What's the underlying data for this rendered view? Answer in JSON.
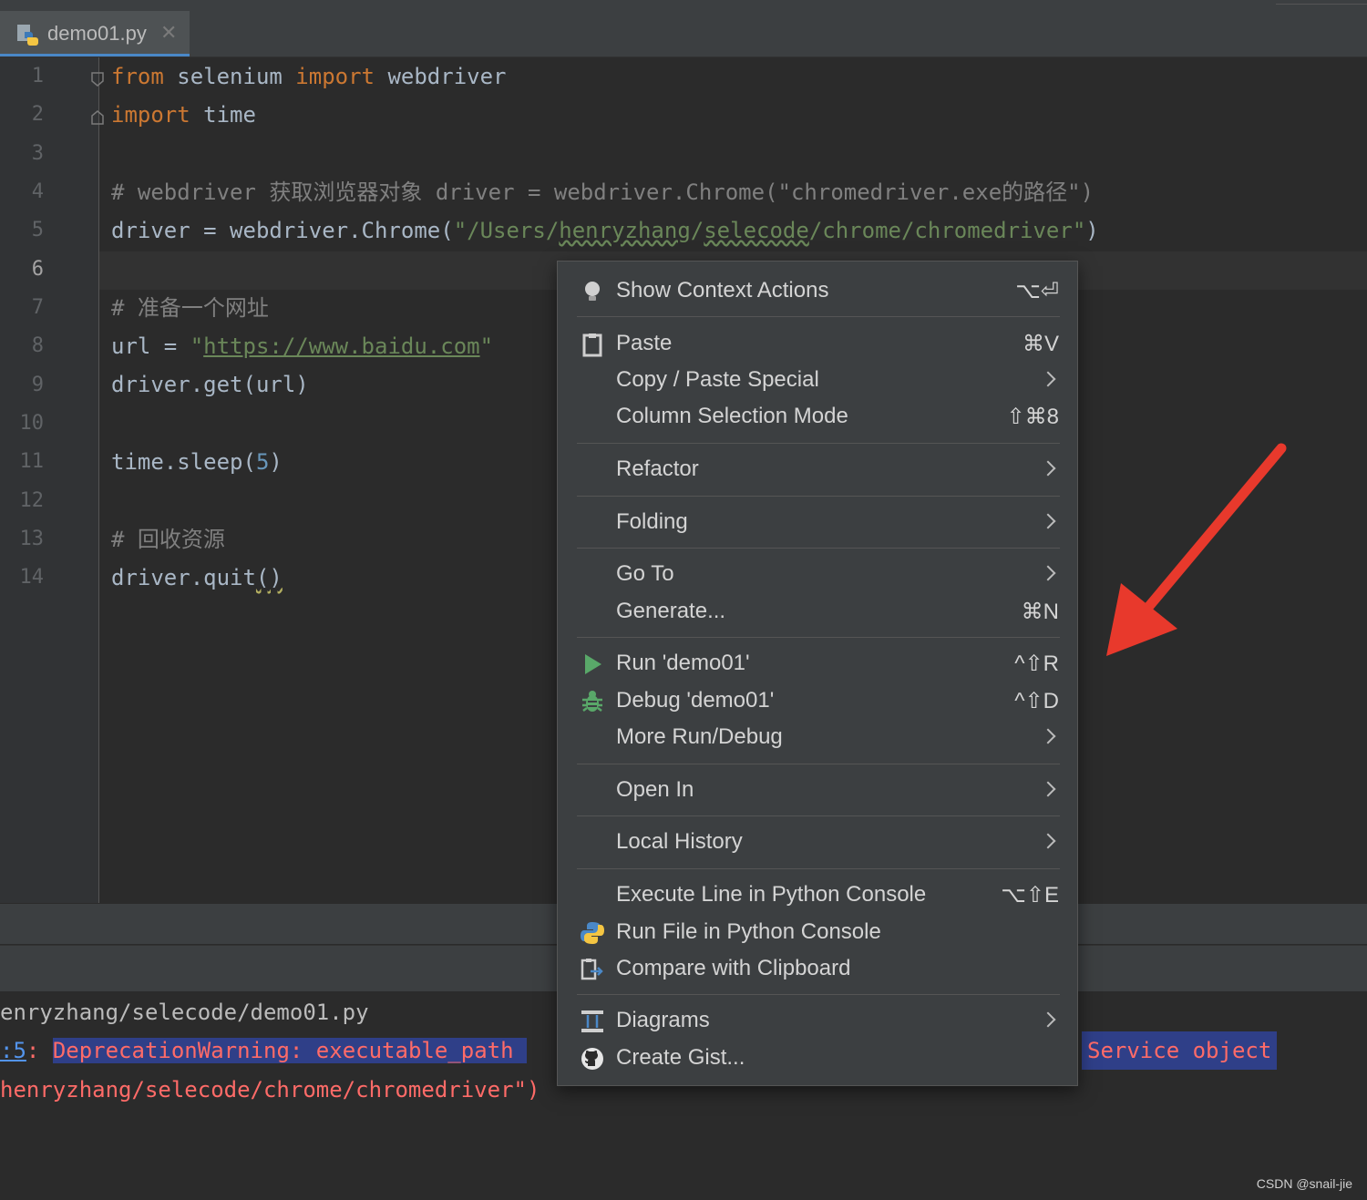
{
  "tab": {
    "filename": "demo01.py",
    "close": "✕"
  },
  "editor": {
    "line_numbers": [
      "1",
      "2",
      "3",
      "4",
      "5",
      "6",
      "7",
      "8",
      "9",
      "10",
      "11",
      "12",
      "13",
      "14"
    ],
    "current_line": "6",
    "lines": {
      "l1": {
        "kw1": "from",
        "t1": " selenium ",
        "kw2": "import",
        "t2": " webdriver"
      },
      "l2": {
        "kw1": "import",
        "t1": " time"
      },
      "l4": {
        "comment": "# webdriver 获取浏览器对象 driver = webdriver.Chrome(\"chromedriver.exe的路径\")"
      },
      "l5": {
        "t1": "driver = webdriver.Chrome(",
        "s1": "\"/Users/",
        "s2": "henryzhang",
        "s3": "/",
        "s4": "selecode",
        "s5": "/chrome/chromedriver\"",
        "t2": ")"
      },
      "l7": {
        "comment": "# 准备一个网址"
      },
      "l8": {
        "t1": "url = ",
        "q1": "\"",
        "url": "https://www.baidu.com",
        "q2": "\""
      },
      "l9": {
        "t1": "driver.get(url)"
      },
      "l11": {
        "t1": "time.sleep(",
        "n1": "5",
        "t2": ")"
      },
      "l13": {
        "comment": "# 回收资源"
      },
      "l14": {
        "t1": "driver.quit",
        "t2": "()"
      }
    }
  },
  "console": {
    "line1": "enryzhang/selecode/demo01.py",
    "line2_link": ":5",
    "line2_colon": ": ",
    "line2_warn": "DeprecationWarning: executable_path ",
    "line2_right": "Service object",
    "line3": "henryzhang/selecode/chrome/chromedriver\")"
  },
  "context_menu": {
    "show_context_actions": {
      "label": "Show Context Actions",
      "shortcut": "⌥⏎"
    },
    "paste": {
      "label": "Paste",
      "shortcut": "⌘V"
    },
    "copy_paste_special": {
      "label": "Copy / Paste Special"
    },
    "column_selection": {
      "label": "Column Selection Mode",
      "shortcut": "⇧⌘8"
    },
    "refactor": {
      "label": "Refactor"
    },
    "folding": {
      "label": "Folding"
    },
    "go_to": {
      "label": "Go To"
    },
    "generate": {
      "label": "Generate...",
      "shortcut": "⌘N"
    },
    "run": {
      "label": "Run 'demo01'",
      "shortcut": "^⇧R"
    },
    "debug": {
      "label": "Debug 'demo01'",
      "shortcut": "^⇧D"
    },
    "more_run_debug": {
      "label": "More Run/Debug"
    },
    "open_in": {
      "label": "Open In"
    },
    "local_history": {
      "label": "Local History"
    },
    "execute_line": {
      "label": "Execute Line in Python Console",
      "shortcut": "⌥⇧E"
    },
    "run_file_console": {
      "label": "Run File in Python Console"
    },
    "compare_clipboard": {
      "label": "Compare with Clipboard"
    },
    "diagrams": {
      "label": "Diagrams"
    },
    "create_gist": {
      "label": "Create Gist..."
    }
  },
  "colors": {
    "accent": "#4a88c7",
    "run_green": "#59a869",
    "arrow_red": "#e8392c",
    "warn_red": "#ff6b68"
  },
  "watermark": "CSDN @snail-jie"
}
